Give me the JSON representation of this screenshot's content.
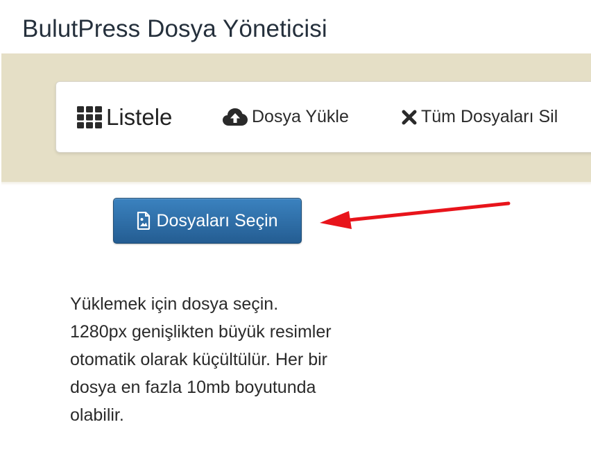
{
  "page": {
    "title": "BulutPress Dosya Yöneticisi"
  },
  "nav": {
    "items": [
      {
        "label": "Listele",
        "icon": "grid-icon"
      },
      {
        "label": "Dosya Yükle",
        "icon": "cloud-upload-icon"
      },
      {
        "label": "Tüm Dosyaları Sil",
        "icon": "close-icon"
      }
    ]
  },
  "upload": {
    "button_label": "Dosyaları Seçin",
    "button_icon": "image-file-icon",
    "info": "Yüklemek için dosya seçin. 1280px genişlikten büyük resimler otomatik olarak küçültülür. Her bir dosya en fazla 10mb boyutunda olabilir."
  },
  "annotation": {
    "arrow_color": "#e8141b"
  },
  "colors": {
    "banner": "#e5dfc6",
    "button": "#2e6fa8",
    "title": "#25303c"
  }
}
